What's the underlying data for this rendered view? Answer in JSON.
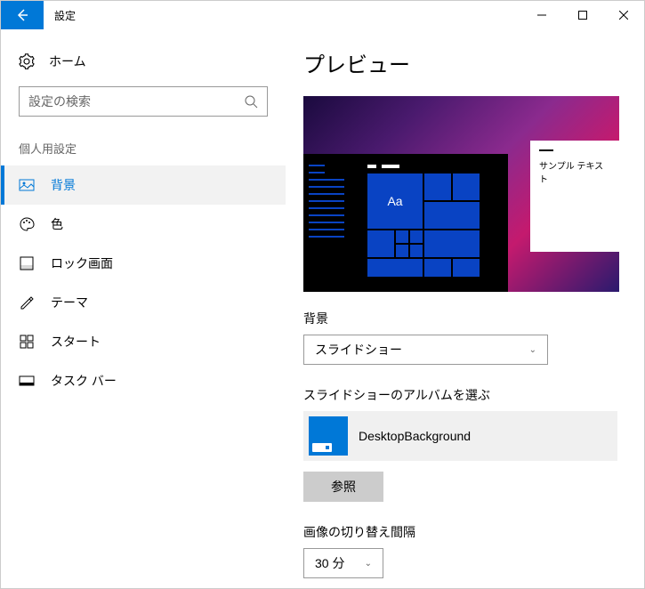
{
  "titlebar": {
    "title": "設定"
  },
  "sidebar": {
    "home": "ホーム",
    "search_placeholder": "設定の検索",
    "section": "個人用設定",
    "items": [
      {
        "label": "背景"
      },
      {
        "label": "色"
      },
      {
        "label": "ロック画面"
      },
      {
        "label": "テーマ"
      },
      {
        "label": "スタート"
      },
      {
        "label": "タスク バー"
      }
    ]
  },
  "main": {
    "title": "プレビュー",
    "sample_text": "サンプル テキスト",
    "aa": "Aa",
    "background_label": "背景",
    "background_value": "スライドショー",
    "album_label": "スライドショーのアルバムを選ぶ",
    "album_name": "DesktopBackground",
    "browse": "参照",
    "interval_label": "画像の切り替え間隔",
    "interval_value": "30 分"
  }
}
